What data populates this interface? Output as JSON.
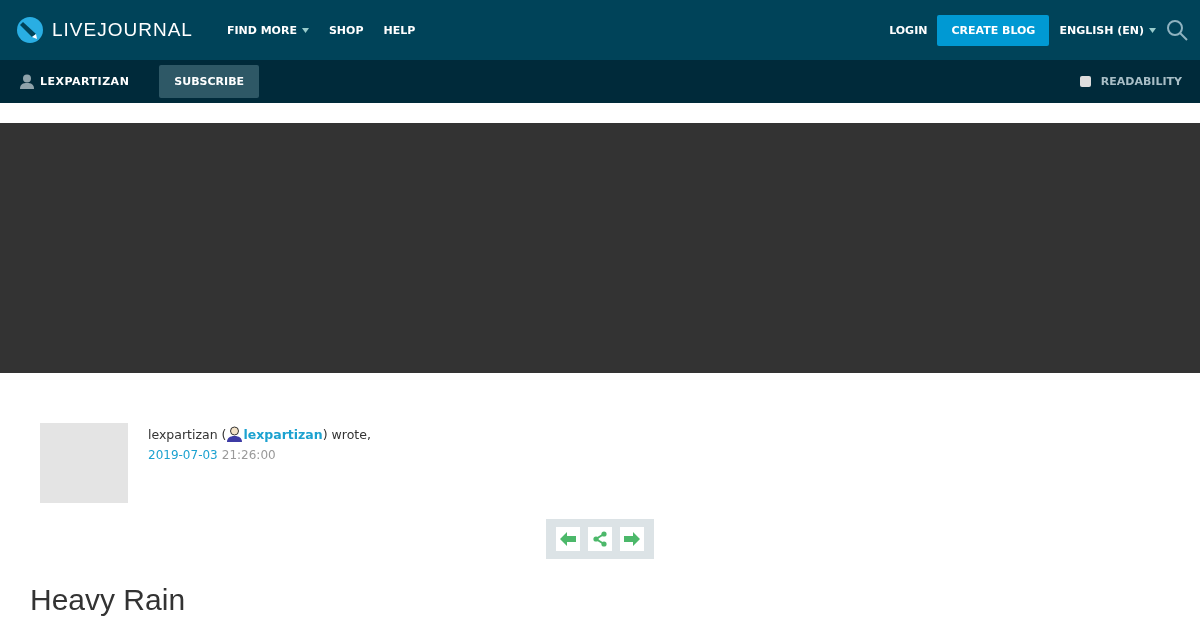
{
  "top_nav": {
    "logo": "LIVEJOURNAL",
    "links": [
      {
        "label": "FIND MORE",
        "dropdown": true
      },
      {
        "label": "SHOP",
        "dropdown": false
      },
      {
        "label": "HELP",
        "dropdown": false
      }
    ],
    "login": "LOGIN",
    "create_blog": "CREATE BLOG",
    "language": "ENGLISH (EN)"
  },
  "journal_bar": {
    "username": "LEXPARTIZAN",
    "subscribe": "SUBSCRIBE",
    "readability": {
      "label": "READABILITY",
      "checked": false
    }
  },
  "entry": {
    "byline_prefix": "lexpartizan (",
    "user_link": "lexpartizan",
    "byline_suffix": ") wrote,",
    "date": "2019-07-03",
    "time": "21:26:00",
    "title": "Heavy Rain"
  }
}
